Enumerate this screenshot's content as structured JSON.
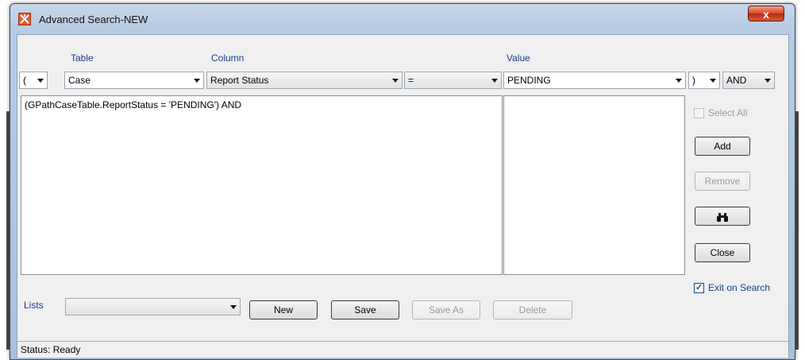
{
  "window": {
    "title": "Advanced Search-NEW",
    "close_glyph": "x"
  },
  "labels": {
    "table": "Table",
    "column": "Column",
    "value": "Value",
    "lists": "Lists"
  },
  "row": {
    "open_paren": "(",
    "table": "Case",
    "column": "Report Status",
    "operator": "=",
    "value": "PENDING",
    "close_paren": ")",
    "conjunction": "AND"
  },
  "expression": "(GPathCaseTable.ReportStatus = 'PENDING') AND",
  "side": {
    "select_all": "Select All",
    "add": "Add",
    "remove": "Remove",
    "search_icon": "binoculars-icon",
    "close": "Close",
    "exit_on_search": "Exit on Search"
  },
  "lists": {
    "selected": "",
    "new": "New",
    "save": "Save",
    "save_as": "Save As",
    "delete": "Delete"
  },
  "status": "Status: Ready",
  "colors": {
    "label_blue": "#1a3d8a",
    "title_bar": "#b7cbe2",
    "close_red": "#d4452a"
  }
}
